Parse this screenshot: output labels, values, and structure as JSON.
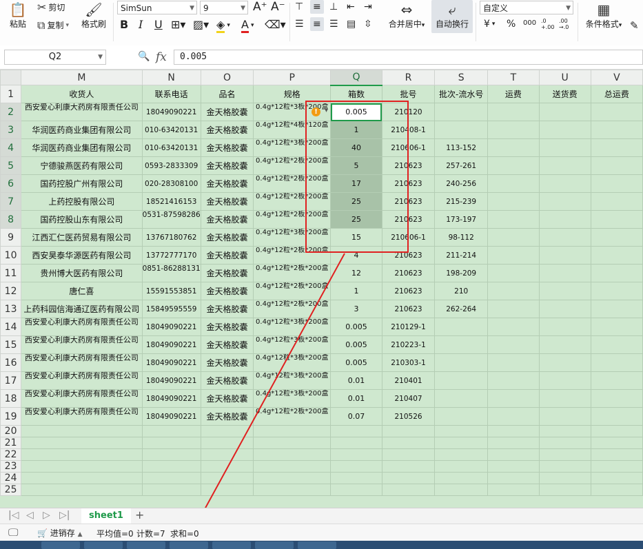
{
  "ribbon": {
    "paste_label": "粘贴",
    "cut_label": "剪切",
    "copy_label": "复制",
    "format_painter_label": "格式刷",
    "font_name": "SimSun",
    "font_size": "9",
    "bold": "B",
    "italic": "I",
    "underline": "U",
    "merge_center_label": "合并居中",
    "wrap_text_label": "自动换行",
    "number_format": "自定义",
    "currency_symbol": "¥",
    "percent_symbol": "%",
    "thousands_symbol": "000",
    "inc_decimal": ".0 +.00",
    "dec_decimal": ".00 →.0",
    "conditional_format_label": "条件格式"
  },
  "formula_bar": {
    "cell_ref": "Q2",
    "fx_label": "fx",
    "value": "0.005"
  },
  "columns": [
    "M",
    "N",
    "O",
    "P",
    "Q",
    "R",
    "S",
    "T",
    "U",
    "V"
  ],
  "header_row": [
    "收货人",
    "联系电话",
    "品名",
    "规格",
    "箱数",
    "批号",
    "批次-流水号",
    "运费",
    "送货费",
    "总运费"
  ],
  "rows": [
    {
      "n": "2",
      "M": "西安爱心利康大药房有限责任公司",
      "N": "18049090221",
      "O": "金天格胶囊",
      "P": "0.4g*12粒*3板*200盒",
      "Q": "0.005",
      "R": "210120",
      "S": ""
    },
    {
      "n": "3",
      "M": "华润医药商业集团有限公司",
      "N": "010-63420131",
      "O": "金天格胶囊",
      "P": "0.4g*12粒*4板*120盒",
      "Q": "1",
      "R": "210408-1",
      "S": ""
    },
    {
      "n": "4",
      "M": "华润医药商业集团有限公司",
      "N": "010-63420131",
      "O": "金天格胶囊",
      "P": "0.4g*12粒*3板*200盒",
      "Q": "40",
      "R": "210606-1",
      "S": "113-152"
    },
    {
      "n": "5",
      "M": "宁德骏燕医药有限公司",
      "N": "0593-2833309",
      "O": "金天格胶囊",
      "P": "0.4g*12粒*2板*200盒",
      "Q": "5",
      "R": "210623",
      "S": "257-261"
    },
    {
      "n": "6",
      "M": "国药控股广州有限公司",
      "N": "020-28308100",
      "O": "金天格胶囊",
      "P": "0.4g*12粒*2板*200盒",
      "Q": "17",
      "R": "210623",
      "S": "240-256"
    },
    {
      "n": "7",
      "M": "上药控股有限公司",
      "N": "18521416153",
      "O": "金天格胶囊",
      "P": "0.4g*12粒*2板*200盒",
      "Q": "25",
      "R": "210623",
      "S": "215-239"
    },
    {
      "n": "8",
      "M": "国药控股山东有限公司",
      "N": "0531-87598286",
      "O": "金天格胶囊",
      "P": "0.4g*12粒*2板*200盒",
      "Q": "25",
      "R": "210623",
      "S": "173-197"
    },
    {
      "n": "9",
      "M": "江西汇仁医药贸易有限公司",
      "N": "13767180762",
      "O": "金天格胶囊",
      "P": "0.4g*12粒*3板*200盒",
      "Q": "15",
      "R": "210606-1",
      "S": "98-112"
    },
    {
      "n": "10",
      "M": "西安昊泰华源医药有限公司",
      "N": "13772777170",
      "O": "金天格胶囊",
      "P": "0.4g*12粒*2板*200盒",
      "Q": "4",
      "R": "210623",
      "S": "211-214"
    },
    {
      "n": "11",
      "M": "贵州博大医药有限公司",
      "N": "0851-86288131",
      "O": "金天格胶囊",
      "P": "0.4g*12粒*2板*200盒",
      "Q": "12",
      "R": "210623",
      "S": "198-209"
    },
    {
      "n": "12",
      "M": "唐仁喜",
      "N": "15591553851",
      "O": "金天格胶囊",
      "P": "0.4g*12粒*2板*200盒",
      "Q": "1",
      "R": "210623",
      "S": "210"
    },
    {
      "n": "13",
      "M": "上药科园信海通辽医药有限公司",
      "N": "15849595559",
      "O": "金天格胶囊",
      "P": "0.4g*12粒*2板*200盒",
      "Q": "3",
      "R": "210623",
      "S": "262-264"
    },
    {
      "n": "14",
      "M": "西安爱心利康大药房有限责任公司",
      "N": "18049090221",
      "O": "金天格胶囊",
      "P": "0.4g*12粒*3板*200盒",
      "Q": "0.005",
      "R": "210129-1",
      "S": ""
    },
    {
      "n": "15",
      "M": "西安爱心利康大药房有限责任公司",
      "N": "18049090221",
      "O": "金天格胶囊",
      "P": "0.4g*12粒*3板*200盒",
      "Q": "0.005",
      "R": "210223-1",
      "S": ""
    },
    {
      "n": "16",
      "M": "西安爱心利康大药房有限责任公司",
      "N": "18049090221",
      "O": "金天格胶囊",
      "P": "0.4g*12粒*3板*200盒",
      "Q": "0.005",
      "R": "210303-1",
      "S": ""
    },
    {
      "n": "17",
      "M": "西安爱心利康大药房有限责任公司",
      "N": "18049090221",
      "O": "金天格胶囊",
      "P": "0.4g*12粒*3板*200盒",
      "Q": "0.01",
      "R": "210401",
      "S": ""
    },
    {
      "n": "18",
      "M": "西安爱心利康大药房有限责任公司",
      "N": "18049090221",
      "O": "金天格胶囊",
      "P": "0.4g*12粒*3板*200盒",
      "Q": "0.01",
      "R": "210407",
      "S": ""
    },
    {
      "n": "19",
      "M": "西安爱心利康大药房有限责任公司",
      "N": "18049090221",
      "O": "金天格胶囊",
      "P": "0.4g*12粒*2板*200盒",
      "Q": "0.07",
      "R": "210526",
      "S": ""
    }
  ],
  "empty_rows": [
    "20",
    "21",
    "22",
    "23",
    "24",
    "25"
  ],
  "sheet_tabs": [
    "sheet1"
  ],
  "status": {
    "workbook_label": "进销存",
    "average": "平均值=0",
    "count": "计数=7",
    "sum": "求和=0"
  }
}
